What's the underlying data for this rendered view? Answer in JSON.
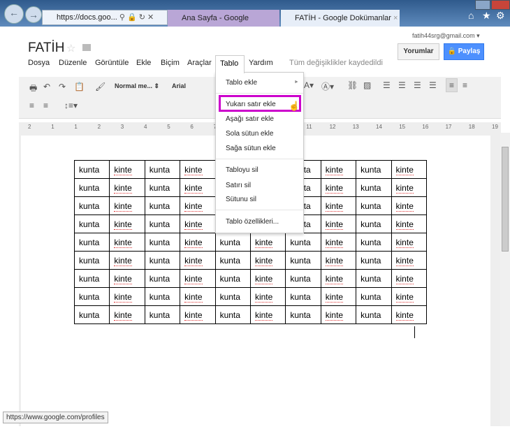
{
  "browser": {
    "address": "https://docs.goo...",
    "tabs": [
      {
        "label": "Ana Sayfa - Google Dokümanlar"
      },
      {
        "label": "FATİH - Google Dokümanlar"
      }
    ],
    "status": "https://www.google.com/profiles"
  },
  "doc": {
    "title": "FATİH",
    "account": "fatih44srg@gmail.com",
    "comments_label": "Yorumlar",
    "share_label": "Paylaş",
    "saved_status": "Tüm değişiklikler kaydedildi"
  },
  "menubar": [
    "Dosya",
    "Düzenle",
    "Görüntüle",
    "Ekle",
    "Biçim",
    "Araçlar",
    "Tablo",
    "Yardım"
  ],
  "toolbar": {
    "style": "Normal me...",
    "font": "Arial"
  },
  "ruler": [
    "2",
    "1",
    "1",
    "2",
    "3",
    "4",
    "5",
    "6",
    "7",
    "8",
    "9",
    "10",
    "11",
    "12",
    "13",
    "14",
    "15",
    "16",
    "17",
    "18",
    "19"
  ],
  "table_menu": {
    "items": [
      "Tablo ekle",
      "Yukarı satır ekle",
      "Aşağı satır ekle",
      "Sola sütun ekle",
      "Sağa sütun ekle",
      "Tabloyu sil",
      "Satırı sil",
      "Sütunu sil",
      "Tablo özellikleri..."
    ],
    "highlighted": "Yukarı satır ekle",
    "highlight_color": "#cc00cc"
  },
  "table": {
    "rows": [
      [
        "kunta",
        "kinte",
        "kunta",
        "kinte",
        "kunta",
        "kinte",
        "kunta",
        "kinte",
        "kunta",
        "kinte"
      ],
      [
        "kunta",
        "kinte",
        "kunta",
        "kinte",
        "kunta",
        "kinte",
        "kunta",
        "kinte",
        "kunta",
        "kinte"
      ],
      [
        "kunta",
        "kinte",
        "kunta",
        "kinte",
        "kunta",
        "kinte",
        "kunta",
        "kinte",
        "kunta",
        "kinte"
      ],
      [
        "kunta",
        "kinte",
        "kunta",
        "kinte",
        "kunta",
        "kinte",
        "kunta",
        "kinte",
        "kunta",
        "kinte"
      ],
      [
        "kunta",
        "kinte",
        "kunta",
        "kinte",
        "kunta",
        "kinte",
        "kunta",
        "kinte",
        "kunta",
        "kinte"
      ],
      [
        "kunta",
        "kinte",
        "kunta",
        "kinte",
        "kunta",
        "kinte",
        "kunta",
        "kinte",
        "kunta",
        "kinte"
      ],
      [
        "kunta",
        "kinte",
        "kunta",
        "kinte",
        "kunta",
        "kinte",
        "kunta",
        "kinte",
        "kunta",
        "kinte"
      ],
      [
        "kunta",
        "kinte",
        "kunta",
        "kinte",
        "kunta",
        "kinte",
        "kunta",
        "kinte",
        "kunta",
        "kinte"
      ],
      [
        "kunta",
        "kinte",
        "kunta",
        "kinte",
        "kunta",
        "kinte",
        "kunta",
        "kinte",
        "kunta",
        "kinte"
      ]
    ]
  }
}
